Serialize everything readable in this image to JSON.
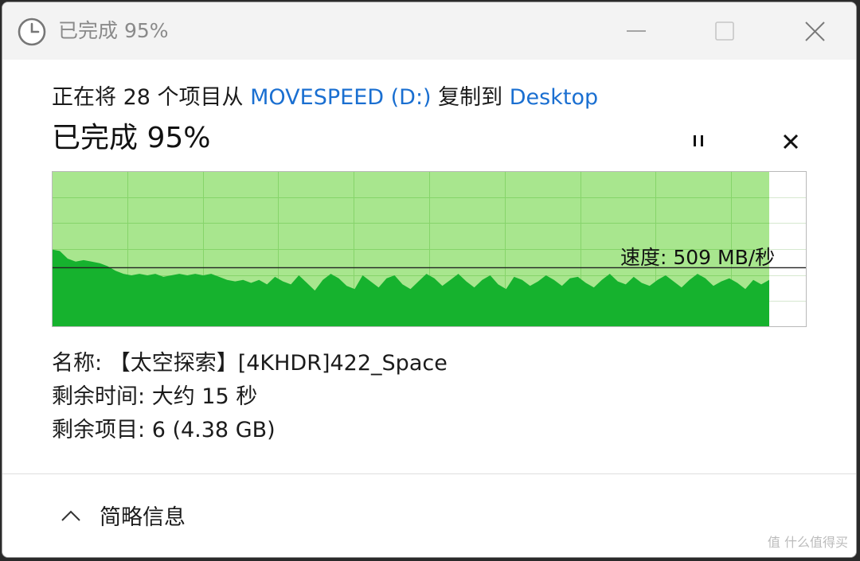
{
  "window": {
    "title": "已完成 95%",
    "icon": "clock-icon",
    "controls": [
      "minimize-icon",
      "maximize-icon",
      "close-icon"
    ]
  },
  "transfer": {
    "prefix": "正在将 28 个项目从 ",
    "source": "MOVESPEED (D:)",
    "middle": " 复制到 ",
    "destination": "Desktop",
    "status": "已完成 95%",
    "progress_percent": 95,
    "speed_label": "速度: 509 MB/秒"
  },
  "details": {
    "name_label": "名称:",
    "name_value": "【太空探索】[4KHDR]422_Space",
    "time_label": "剩余时间:",
    "time_value": "大约 15 秒",
    "items_label": "剩余项目:",
    "items_value": "6 (4.38 GB)"
  },
  "footer": {
    "toggle_label": "简略信息",
    "toggle_icon": "chevron-up-icon"
  },
  "watermark": "值 什么值得买",
  "colors": {
    "chart_fill_light": "#a8e68e",
    "chart_fill_dark": "#16b22e",
    "chart_grid": "#86d46a",
    "link": "#1a6fd1"
  },
  "chart_data": {
    "type": "area",
    "progress": 0.95,
    "speed_line": 0.38,
    "values": [
      0.5,
      0.49,
      0.44,
      0.42,
      0.43,
      0.42,
      0.41,
      0.39,
      0.36,
      0.34,
      0.33,
      0.34,
      0.33,
      0.34,
      0.32,
      0.33,
      0.34,
      0.33,
      0.34,
      0.33,
      0.34,
      0.32,
      0.3,
      0.29,
      0.3,
      0.28,
      0.3,
      0.27,
      0.32,
      0.29,
      0.27,
      0.33,
      0.28,
      0.23,
      0.3,
      0.34,
      0.31,
      0.26,
      0.24,
      0.33,
      0.29,
      0.25,
      0.31,
      0.33,
      0.27,
      0.24,
      0.29,
      0.34,
      0.31,
      0.26,
      0.3,
      0.34,
      0.29,
      0.25,
      0.3,
      0.33,
      0.27,
      0.24,
      0.32,
      0.3,
      0.26,
      0.29,
      0.33,
      0.3,
      0.26,
      0.31,
      0.32,
      0.28,
      0.25,
      0.3,
      0.34,
      0.29,
      0.27,
      0.32,
      0.28,
      0.26,
      0.3,
      0.33,
      0.29,
      0.25,
      0.3,
      0.34,
      0.31,
      0.26,
      0.29,
      0.31,
      0.28,
      0.24,
      0.3,
      0.27,
      0.3
    ]
  }
}
